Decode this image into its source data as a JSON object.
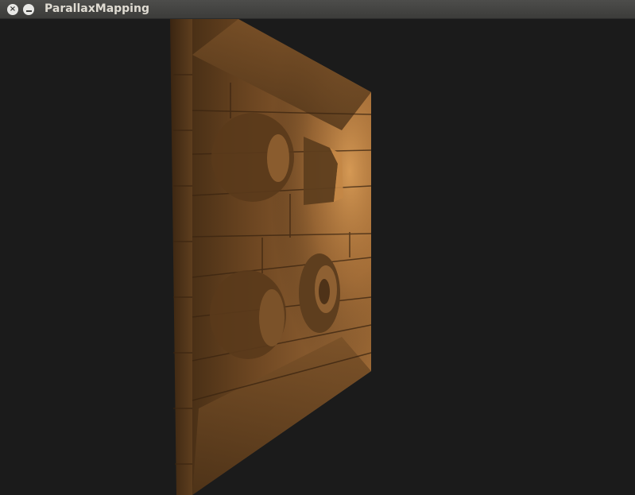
{
  "window": {
    "title": "ParallaxMapping",
    "close_glyph": "×",
    "minimize_icon": "minimize-icon"
  },
  "scene": {
    "background": "#1b1b1b",
    "wood_light": "#c68a4a",
    "wood_mid": "#8e5f31",
    "wood_dark": "#4a3016"
  }
}
